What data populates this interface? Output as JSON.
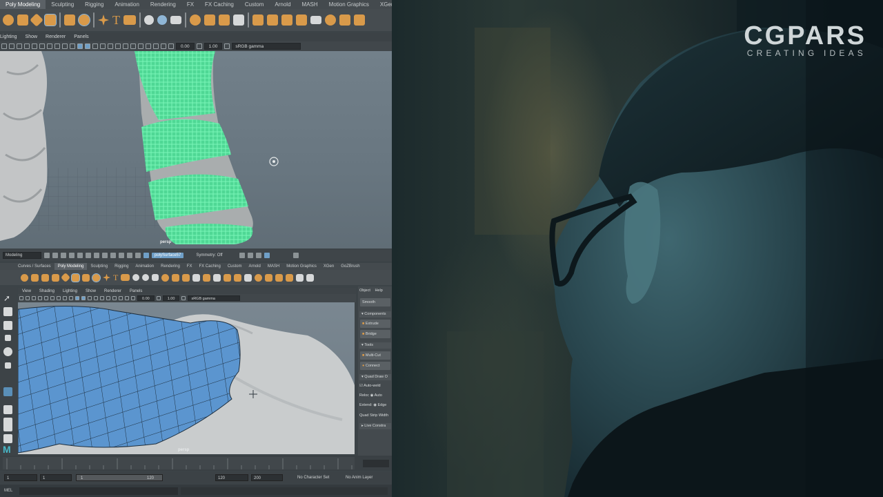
{
  "maya_top": {
    "shelf_tabs": [
      "Poly Modeling",
      "Sculpting",
      "Rigging",
      "Animation",
      "Rendering",
      "FX",
      "FX Caching",
      "Custom",
      "Arnold",
      "MASH",
      "Motion Graphics",
      "XGen"
    ],
    "active_tab": "Poly Modeling",
    "panel_menu": [
      "Lighting",
      "Show",
      "Renderer",
      "Panels"
    ],
    "exposure": "0.00",
    "gamma": "1.00",
    "color_space": "sRGB gamma",
    "viewport_label": "persp"
  },
  "status_line": {
    "mode": "Modeling",
    "object_field": "polySurface57",
    "symmetry": "Symmetry: Off"
  },
  "maya_bottom": {
    "shelf_tabs": [
      "Curves / Surfaces",
      "Poly Modeling",
      "Sculpting",
      "Rigging",
      "Animation",
      "Rendering",
      "FX",
      "FX Caching",
      "Custom",
      "Arnold",
      "MASH",
      "Motion Graphics",
      "XGen",
      "GoZBrush"
    ],
    "active_tab": "Poly Modeling",
    "panel_menu": [
      "View",
      "Shading",
      "Lighting",
      "Show",
      "Renderer",
      "Panels"
    ],
    "exposure": "0.00",
    "gamma": "1.00",
    "color_space": "sRGB gamma",
    "viewport_label": "persp"
  },
  "modeling_toolkit": {
    "menu": [
      "Object",
      "Help"
    ],
    "smooth": "Smooth",
    "components_header": "Components",
    "extrude": "Extrude",
    "bridge": "Bridge",
    "tools_header": "Tools",
    "multicut": "Multi-Cut",
    "connect": "Connect",
    "quad_draw_header": "Quad Draw O",
    "auto_weld": "Auto-weld",
    "reloc_label": "Reloc",
    "reloc_value": "Auto",
    "extend_label": "Extend:",
    "extend_value": "Edge",
    "quad_strip": "Quad Strip Width",
    "live_constraint": "Live Constra"
  },
  "range": {
    "start": "1",
    "playback_start": "1",
    "slider_start": "1",
    "slider_end": "120",
    "playback_end": "120",
    "end": "200",
    "character_set": "No Character Set",
    "anim_layer": "No Anim Layer"
  },
  "command_line": {
    "label": "MEL"
  },
  "brand": {
    "name": "CGPARS",
    "tagline": "CREATING IDEAS"
  },
  "colors": {
    "selection_green": "#5ef0a4",
    "face_blue": "#5b95cf",
    "maya_bg": "#3c4347"
  }
}
